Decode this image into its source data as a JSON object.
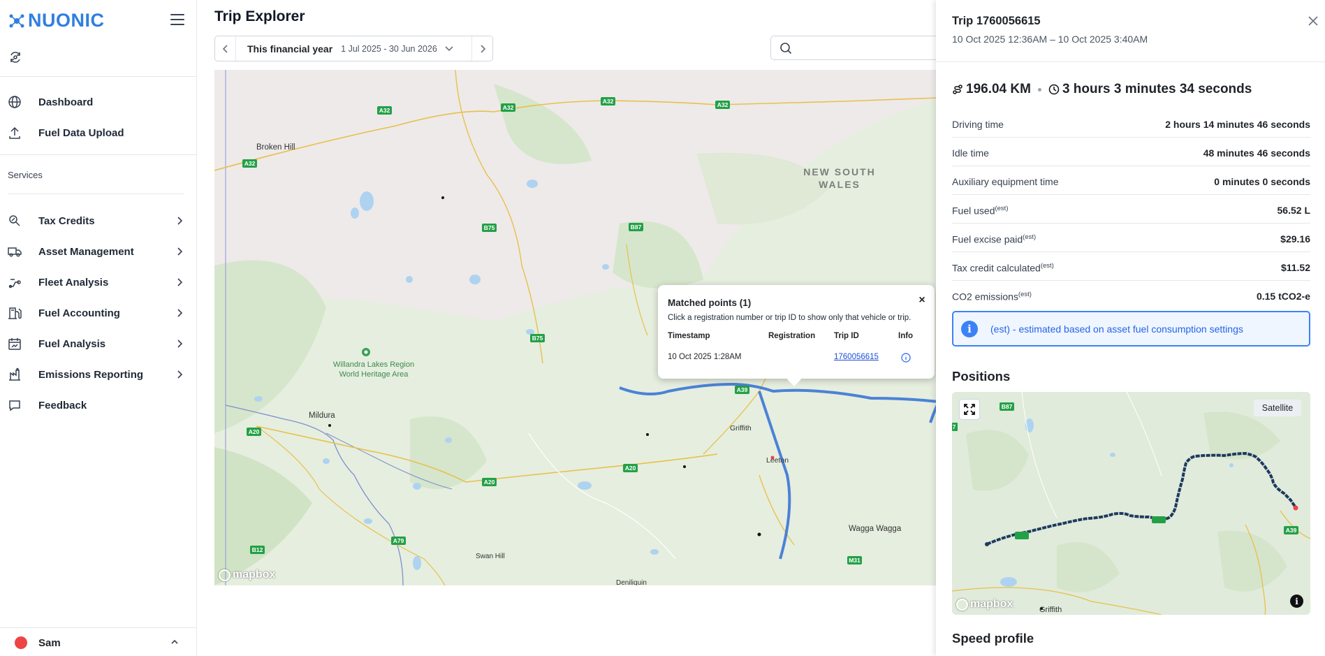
{
  "app": {
    "brand": "NUONIC"
  },
  "sidebar": {
    "top_items": [
      {
        "label": "Dashboard",
        "icon": "globe-icon"
      },
      {
        "label": "Fuel Data Upload",
        "icon": "upload-icon"
      }
    ],
    "section_label": "Services",
    "service_items": [
      {
        "label": "Tax Credits",
        "icon": "tax-credit-icon"
      },
      {
        "label": "Asset Management",
        "icon": "truck-icon"
      },
      {
        "label": "Fleet Analysis",
        "icon": "fleet-route-icon"
      },
      {
        "label": "Fuel Accounting",
        "icon": "fuel-pump-icon"
      },
      {
        "label": "Fuel Analysis",
        "icon": "calendar-chart-icon"
      },
      {
        "label": "Emissions Reporting",
        "icon": "emissions-icon"
      }
    ],
    "feedback": {
      "label": "Feedback",
      "icon": "chat-icon"
    },
    "user": {
      "name": "Sam"
    }
  },
  "main": {
    "title": "Trip Explorer",
    "date_filter": {
      "period": "This financial year",
      "range": "1 Jul 2025 - 30 Jun 2026"
    },
    "search": {
      "placeholder": ""
    }
  },
  "map": {
    "labels": {
      "broken_hill": "Broken Hill",
      "nsw_1": "NEW SOUTH",
      "nsw_2": "WALES",
      "willandra_1": "Willandra Lakes Region",
      "willandra_2": "World Heritage Area",
      "mildura": "Mildura",
      "griffith": "Griffith",
      "leeton": "Leeton",
      "wagga": "Wagga Wagga",
      "swan_hill": "Swan Hill",
      "deniliquin": "Deniliquin"
    },
    "shields": {
      "a32": "A32",
      "b75": "B75",
      "b87": "B87",
      "a39": "A39",
      "a20": "A20",
      "a79": "A79",
      "b12": "B12",
      "m31": "M31"
    },
    "attribution": "mapbox"
  },
  "popup": {
    "title": "Matched points (1)",
    "description": "Click a registration number or trip ID to show only that vehicle or trip.",
    "columns": [
      "Timestamp",
      "Registration",
      "Trip ID",
      "Info"
    ],
    "rows": [
      {
        "timestamp": "10 Oct 2025 1:28AM",
        "registration": "",
        "trip_id": "1760056615"
      }
    ],
    "close": "×"
  },
  "panel": {
    "title": "Trip 1760056615",
    "subtitle": "10 Oct 2025 12:36AM – 10 Oct 2025 3:40AM",
    "distance": "196.04 KM",
    "duration": "3 hours 3 minutes 34 seconds",
    "stats": [
      {
        "label": "Driving time",
        "est": "",
        "value": "2 hours 14 minutes 46 seconds"
      },
      {
        "label": "Idle time",
        "est": "",
        "value": "48 minutes 46 seconds"
      },
      {
        "label": "Auxiliary equipment time",
        "est": "",
        "value": "0 minutes 0 seconds"
      },
      {
        "label": "Fuel used",
        "est": "(est)",
        "value": "56.52 L"
      },
      {
        "label": "Fuel excise paid",
        "est": "(est)",
        "value": "$29.16"
      },
      {
        "label": "Tax credit calculated",
        "est": "(est)",
        "value": "$11.52"
      },
      {
        "label": "CO2 emissions",
        "est": "(est)",
        "value": "0.15 tCO2-e"
      }
    ],
    "info_note": "(est) - estimated based on asset fuel consumption settings",
    "positions_heading": "Positions",
    "satellite_label": "Satellite",
    "minimap": {
      "shields": {
        "b87": "B87",
        "a39": "A39",
        "seven": "7"
      },
      "griffith": "Griffith",
      "attribution": "mapbox"
    },
    "speed_heading": "Speed profile"
  },
  "colors": {
    "brand": "#2f7fe0",
    "route": "#2563eb",
    "accent_info": "#3b82f6",
    "road_shield": "#16a34a"
  }
}
